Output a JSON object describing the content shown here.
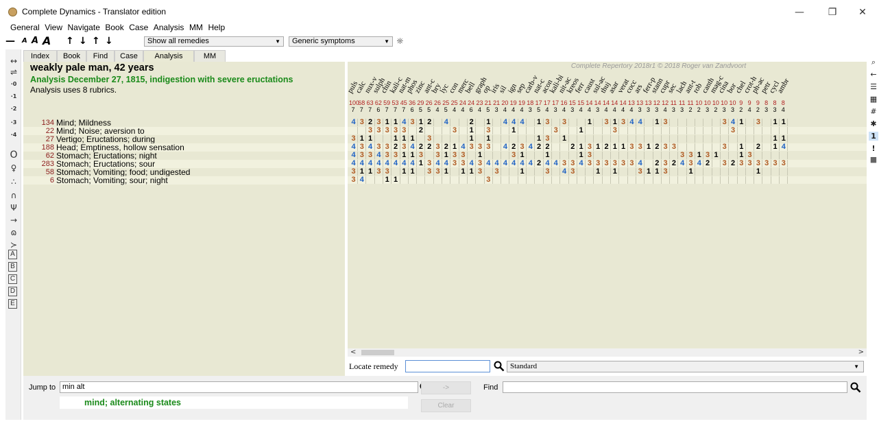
{
  "window": {
    "title": "Complete Dynamics - Translator edition",
    "controls": {
      "minimize": "—",
      "restore": "❐",
      "close": "✕"
    }
  },
  "menu": [
    "General",
    "View",
    "Navigate",
    "Book",
    "Case",
    "Analysis",
    "MM",
    "Help"
  ],
  "toolbar": {
    "dash": "—",
    "font_small": "A",
    "font_medium": "A",
    "font_large": "A",
    "arrows": [
      "↑",
      "↓",
      "↑",
      "↓"
    ],
    "remedy_filter": "Show all remedies",
    "symptom_filter": "Generic symptoms"
  },
  "tabs": [
    "Index",
    "Book",
    "Find",
    "Case",
    "Analysis",
    "MM"
  ],
  "active_tab": "Analysis",
  "left_strip": {
    "top_items": [
      "↔",
      "⇌",
      "·0",
      "·1",
      "·2",
      "·3",
      "·4"
    ],
    "symbols": [
      "O",
      "♀",
      "∴",
      "∩",
      "Ψ",
      "→",
      "ɷ",
      "≻"
    ],
    "letters": [
      "A",
      "B",
      "C",
      "D",
      "E"
    ]
  },
  "case": {
    "title": "weakly pale man, 42 years",
    "analysis_title": "Analysis December 27, 1815, indigestion with severe eructations",
    "analysis_uses": "Analysis uses 8 rubrics."
  },
  "rubrics": [
    {
      "count": "134",
      "text": "Mind; Mildness"
    },
    {
      "count": "22",
      "text": "Mind; Noise; aversion to"
    },
    {
      "count": "27",
      "text": "Vertigo; Eructations; during"
    },
    {
      "count": "188",
      "text": "Head; Emptiness, hollow sensation"
    },
    {
      "count": "62",
      "text": "Stomach; Eructations; night"
    },
    {
      "count": "283",
      "text": "Stomach; Eructations; sour"
    },
    {
      "count": "58",
      "text": "Stomach; Vomiting; food; undigested"
    },
    {
      "count": "6",
      "text": "Stomach; Vomiting; sour; night"
    }
  ],
  "grid": {
    "copyright": "Complete Repertory 2018r1 © 2018 Roger van Zandvoort",
    "remedies": [
      "puls",
      "calc",
      "nux-v",
      "sulph",
      "chin",
      "kali-c",
      "nat-m",
      "phos",
      "zinc",
      "ant-c",
      "bry",
      "lyc",
      "con",
      "merc",
      "bell",
      "graph",
      "op",
      "iris",
      "sil",
      "ign",
      "sep",
      "carb-v",
      "nat-c",
      "acon",
      "kali-bi",
      "nit-ac",
      "kreos",
      "ferr",
      "caust",
      "sul-ac",
      "thuj",
      "asar",
      "verat",
      "cocc",
      "ars",
      "ferr-p",
      "stann",
      "cupr",
      "sec",
      "lach",
      "ant-t",
      "rob",
      "canth",
      "mag-c",
      "cina",
      "bor",
      "chel",
      "crot-h",
      "ph-ac",
      "petr",
      "cycl",
      "ambr"
    ],
    "totals": [
      "100",
      "68",
      "63",
      "62",
      "59",
      "53",
      "45",
      "36",
      "29",
      "26",
      "26",
      "25",
      "25",
      "24",
      "24",
      "23",
      "21",
      "21",
      "20",
      "19",
      "19",
      "18",
      "17",
      "17",
      "17",
      "16",
      "15",
      "15",
      "14",
      "14",
      "14",
      "14",
      "14",
      "13",
      "13",
      "13",
      "12",
      "12",
      "11",
      "11",
      "11",
      "10",
      "10",
      "10",
      "10",
      "10",
      "9",
      "9",
      "9",
      "8",
      "8",
      "8"
    ],
    "counts": [
      "7",
      "7",
      "7",
      "6",
      "7",
      "7",
      "7",
      "6",
      "5",
      "5",
      "4",
      "5",
      "4",
      "4",
      "6",
      "4",
      "5",
      "3",
      "4",
      "4",
      "4",
      "3",
      "5",
      "4",
      "3",
      "4",
      "3",
      "4",
      "4",
      "3",
      "4",
      "4",
      "4",
      "4",
      "3",
      "3",
      "3",
      "4",
      "3",
      "3",
      "2",
      "2",
      "3",
      "2",
      "3",
      "3",
      "2",
      "4",
      "2",
      "3",
      "3",
      "4"
    ],
    "rows": [
      [
        "4",
        "3",
        "2",
        "3",
        "1",
        "1",
        "4",
        "3",
        "1",
        "2",
        "",
        "4",
        "",
        "",
        "2",
        "",
        "1",
        "",
        "4",
        "4",
        "4",
        "",
        "1",
        "3",
        "",
        "3",
        "",
        "",
        "1",
        "",
        "3",
        "1",
        "3",
        "4",
        "4",
        "",
        "1",
        "3",
        "",
        "",
        "",
        "",
        "",
        "",
        "3",
        "4",
        "1",
        "",
        "3",
        "",
        "1",
        "1"
      ],
      [
        "",
        "",
        "3",
        "3",
        "3",
        "3",
        "3",
        "",
        "2",
        "",
        "",
        "",
        "3",
        "",
        "1",
        "",
        "3",
        "",
        "",
        "1",
        "",
        "",
        "",
        "",
        "3",
        "",
        "",
        "1",
        "",
        "",
        "",
        "3",
        "",
        "",
        "",
        "",
        "",
        "",
        "",
        "",
        "",
        "",
        "",
        "",
        "",
        "3",
        "",
        "",
        "",
        "",
        "",
        ""
      ],
      [
        "3",
        "1",
        "1",
        "",
        "",
        "1",
        "1",
        "1",
        "",
        "3",
        "",
        "",
        "",
        "",
        "1",
        "",
        "1",
        "",
        "",
        "",
        "",
        "",
        "1",
        "3",
        "",
        "1",
        "",
        "",
        "",
        "",
        "",
        "",
        "",
        "",
        "",
        "",
        "",
        "",
        "",
        "",
        "",
        "",
        "",
        "",
        "",
        "",
        "",
        "",
        "",
        "",
        "1",
        "1"
      ],
      [
        "4",
        "3",
        "4",
        "3",
        "3",
        "2",
        "3",
        "4",
        "2",
        "2",
        "3",
        "2",
        "1",
        "4",
        "3",
        "3",
        "3",
        "",
        "4",
        "2",
        "3",
        "4",
        "2",
        "2",
        "",
        "",
        "2",
        "1",
        "3",
        "1",
        "2",
        "1",
        "1",
        "3",
        "3",
        "1",
        "2",
        "3",
        "3",
        "",
        "",
        "",
        "",
        "",
        "3",
        "",
        "1",
        "",
        "2",
        "",
        "1",
        "4"
      ],
      [
        "4",
        "3",
        "3",
        "4",
        "3",
        "3",
        "1",
        "1",
        "3",
        "",
        "3",
        "1",
        "3",
        "3",
        "",
        "1",
        "",
        "",
        "",
        "3",
        "1",
        "",
        "",
        "1",
        "",
        "",
        "",
        "1",
        "3",
        "",
        "",
        "",
        "",
        "",
        "",
        "",
        "",
        "",
        "",
        "3",
        "3",
        "1",
        "3",
        "1",
        "",
        "",
        "1",
        "3",
        "",
        "",
        "",
        ""
      ],
      [
        "4",
        "4",
        "4",
        "4",
        "4",
        "4",
        "4",
        "4",
        "1",
        "3",
        "4",
        "4",
        "3",
        "3",
        "4",
        "3",
        "4",
        "4",
        "4",
        "4",
        "4",
        "4",
        "2",
        "4",
        "4",
        "3",
        "3",
        "4",
        "3",
        "3",
        "3",
        "3",
        "3",
        "3",
        "4",
        "",
        "2",
        "3",
        "2",
        "4",
        "3",
        "4",
        "2",
        "",
        "3",
        "2",
        "3",
        "3",
        "3",
        "3",
        "3",
        "3"
      ],
      [
        "3",
        "1",
        "1",
        "3",
        "3",
        "",
        "1",
        "1",
        "",
        "3",
        "3",
        "1",
        "",
        "1",
        "1",
        "3",
        "",
        "3",
        "",
        "",
        "1",
        "",
        "",
        "3",
        "",
        "4",
        "3",
        "",
        "",
        "1",
        "",
        "1",
        "",
        "",
        "3",
        "1",
        "1",
        "3",
        "",
        "",
        "1",
        "",
        "",
        "",
        "",
        "",
        "",
        "",
        "1",
        "",
        "",
        ""
      ],
      [
        "3",
        "4",
        "",
        "",
        "1",
        "1",
        "",
        "",
        "",
        "",
        "",
        "",
        "",
        "",
        "",
        "",
        "3",
        "",
        "",
        "",
        "",
        "",
        "",
        "",
        "",
        "",
        "",
        "",
        "",
        "",
        "",
        "",
        "",
        "",
        "",
        "",
        "",
        "",
        "",
        "",
        "",
        "",
        "",
        "",
        "",
        "",
        "",
        "",
        "",
        "",
        "",
        ""
      ]
    ]
  },
  "locate": {
    "label": "Locate remedy",
    "value": "",
    "mode": "Standard"
  },
  "bottom": {
    "jump_label": "Jump to",
    "jump_value": "min alt",
    "jump_suggestion": "mind; alternating states",
    "go_button": "->",
    "clear_button": "Clear",
    "find_label": "Find",
    "find_value": ""
  },
  "right_strip": [
    "⌕",
    "←",
    "☰",
    "▦",
    "#",
    "✱",
    "1",
    "!",
    "■"
  ],
  "colors": {
    "pane_bg": "#e8e8d3",
    "grade4": "#1f62c4",
    "grade3": "#b05a22",
    "grade1": "#000000",
    "analysis_green": "#1a8a1a"
  }
}
